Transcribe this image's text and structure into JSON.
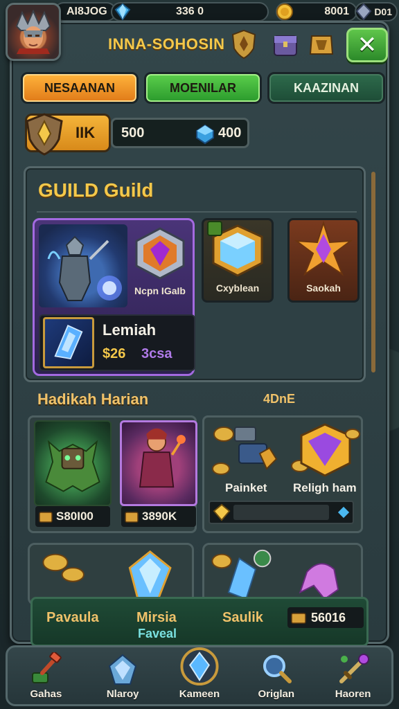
{
  "topbar": {
    "player_id": "AI8JOG",
    "gems": "336 0",
    "coins": "8001",
    "crystals": "D01"
  },
  "header": {
    "title": "INNA-SOHOSIN",
    "close_label": "✕"
  },
  "tabs": [
    {
      "label": "NESAANAN"
    },
    {
      "label": "MOENILAR"
    },
    {
      "label": "KAAZINAN"
    }
  ],
  "rank": {
    "label": "IIK",
    "resource_left": "500",
    "resource_right": "400"
  },
  "guild": {
    "title": "GUILD Guild",
    "featured_item_name": "Ncpn IGaIb",
    "offer_name": "Lemiah",
    "offer_price": "$26",
    "offer_tag": "3csa",
    "cards": [
      {
        "name": "Cxyblean"
      },
      {
        "name": "Saokah"
      }
    ]
  },
  "daily": {
    "title": "Hadikah Harian",
    "timer": "4DnE",
    "heroes": [
      {
        "price": "S80I00"
      },
      {
        "price": "3890K"
      }
    ],
    "items": [
      {
        "name": "Painket"
      },
      {
        "name": "Religh ham"
      }
    ]
  },
  "footer_strip": {
    "labels": [
      "Pavaula",
      "Mirsia",
      "Saulik"
    ],
    "sub": "Faveal",
    "price": "56016"
  },
  "bottom_nav": [
    {
      "label": "Gahas",
      "icon": "hammer-icon"
    },
    {
      "label": "Nlaroy",
      "icon": "crystal-icon"
    },
    {
      "label": "Kameen",
      "icon": "gem-orb-icon"
    },
    {
      "label": "Origlan",
      "icon": "magnifier-icon"
    },
    {
      "label": "Haoren",
      "icon": "sword-icon"
    }
  ],
  "colors": {
    "accent_gold": "#f4c84a",
    "tab_orange": "#f09a2a",
    "tab_green": "#3fb43c",
    "tab_dark_green": "#245a40",
    "featured_purple": "#a36ae0"
  }
}
